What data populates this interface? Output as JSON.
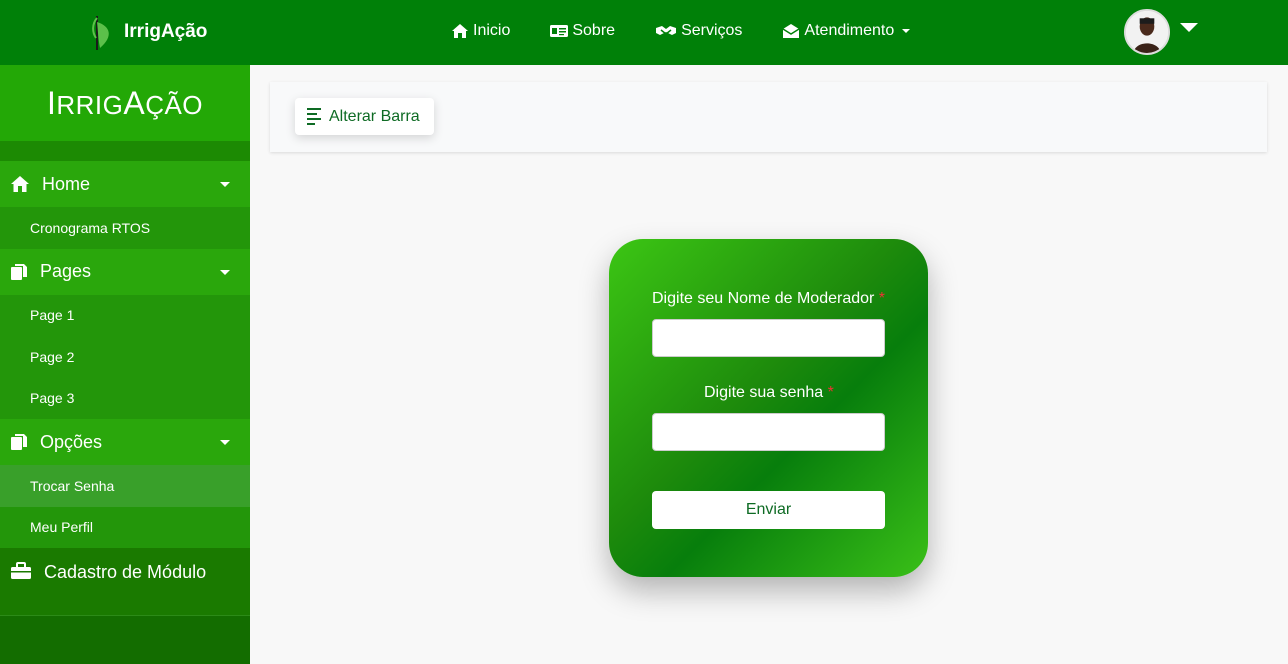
{
  "navbar": {
    "brand": "IrrigAção",
    "links": [
      {
        "label": "Inicio",
        "icon": "home-icon"
      },
      {
        "label": "Sobre",
        "icon": "id-card-icon"
      },
      {
        "label": "Serviços",
        "icon": "handshake-icon"
      },
      {
        "label": "Atendimento",
        "icon": "envelope-open-icon",
        "dropdown": true
      }
    ]
  },
  "sidebar": {
    "title_first": "I",
    "title_mid1": "RRIG",
    "title_mid2": "A",
    "title_end": "ÇÃO",
    "sections": [
      {
        "label": "Home",
        "icon": "home-icon",
        "items": [
          "Cronograma RTOS"
        ]
      },
      {
        "label": "Pages",
        "icon": "copy-icon",
        "items": [
          "Page 1",
          "Page 2",
          "Page 3"
        ]
      },
      {
        "label": "Opções",
        "icon": "copy-icon",
        "items": [
          "Trocar Senha",
          "Meu Perfil"
        ],
        "active_item": "Trocar Senha"
      }
    ],
    "extra": {
      "label": "Cadastro de Módulo",
      "icon": "toolbox-icon"
    }
  },
  "main": {
    "toggle_label": "Alterar Barra"
  },
  "form": {
    "username_label": "Digite seu Nome de Moderador",
    "password_label": "Digite sua senha",
    "required_mark": "*",
    "username_value": "",
    "password_value": "",
    "submit_label": "Enviar"
  },
  "colors": {
    "navbar": "#008008",
    "sidebar_section": "#2aa70c",
    "sidebar_item": "#23960a",
    "accent_text": "#0e6b24"
  }
}
